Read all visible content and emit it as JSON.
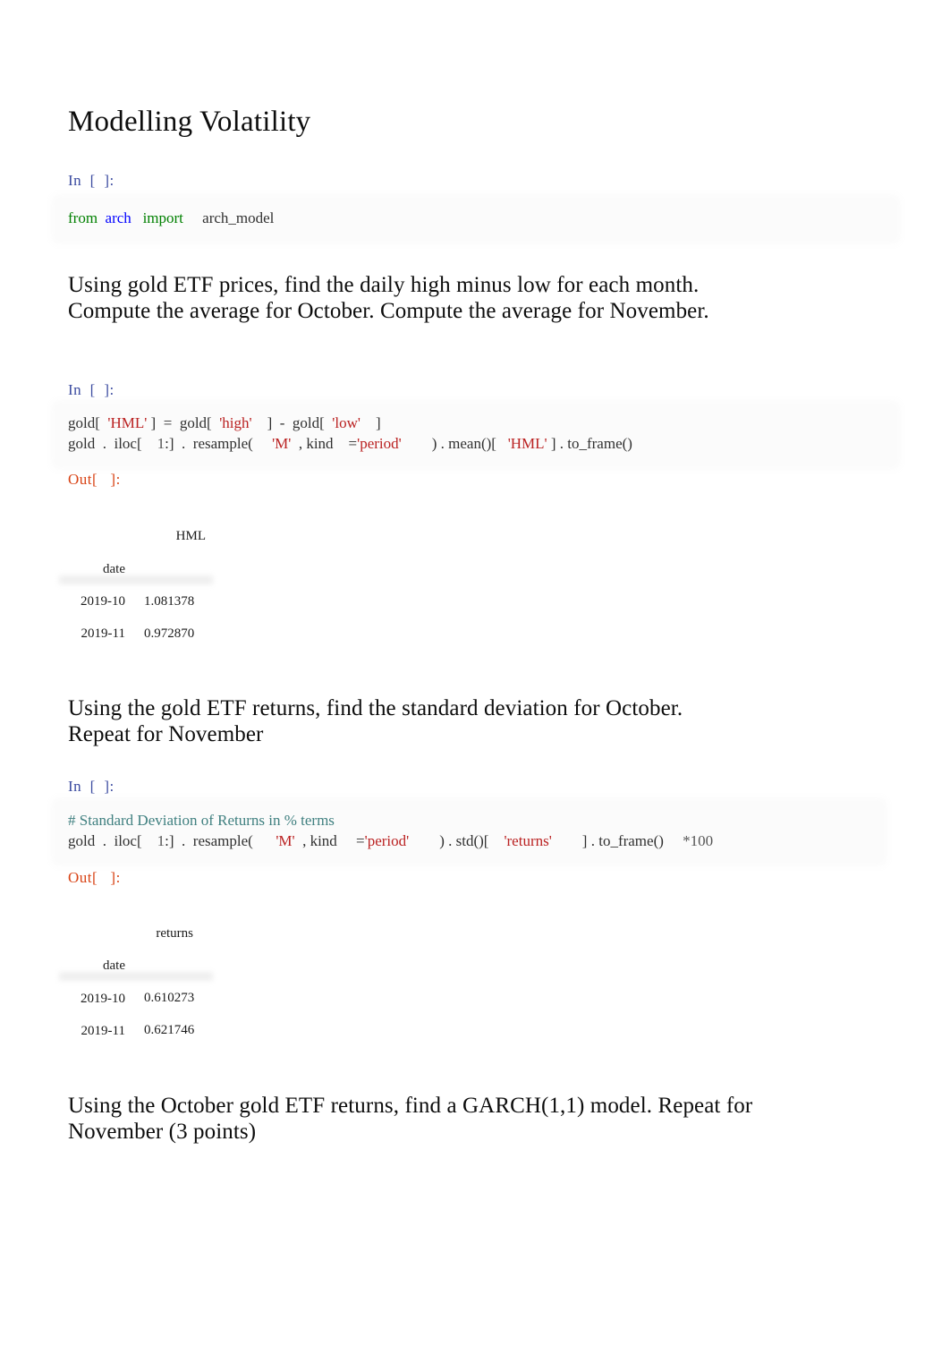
{
  "document": {
    "title": "Modelling Volatility"
  },
  "cells": [
    {
      "kind": "code",
      "prompt": "In  [  ]:",
      "lines": [
        [
          {
            "t": "from",
            "c": "kw"
          },
          {
            "t": "  ",
            "c": "plain"
          },
          {
            "t": "arch",
            "c": "name"
          },
          {
            "t": "   ",
            "c": "plain"
          },
          {
            "t": "import",
            "c": "kw"
          },
          {
            "t": "     ",
            "c": "plain"
          },
          {
            "t": "arch_model",
            "c": "plain"
          }
        ]
      ]
    },
    {
      "kind": "markdown",
      "text": "Using gold ETF prices, find the daily high minus low for each month. Compute the average for October. Compute the average for November."
    },
    {
      "kind": "code",
      "prompt": "In  [  ]:",
      "lines": [
        [
          {
            "t": "gold[",
            "c": "plain"
          },
          {
            "t": "  ",
            "c": "plain"
          },
          {
            "t": "'HML'",
            "c": "str"
          },
          {
            "t": " ]",
            "c": "plain"
          },
          {
            "t": "  =  ",
            "c": "plain"
          },
          {
            "t": "gold[",
            "c": "plain"
          },
          {
            "t": "  ",
            "c": "plain"
          },
          {
            "t": "'high'",
            "c": "str"
          },
          {
            "t": "    ]",
            "c": "plain"
          },
          {
            "t": "  -  ",
            "c": "plain"
          },
          {
            "t": "gold[",
            "c": "plain"
          },
          {
            "t": "  ",
            "c": "plain"
          },
          {
            "t": "'low'",
            "c": "str"
          },
          {
            "t": "    ]",
            "c": "plain"
          }
        ],
        [
          {
            "t": "gold",
            "c": "plain"
          },
          {
            "t": "  .  ",
            "c": "plain"
          },
          {
            "t": "iloc[",
            "c": "plain"
          },
          {
            "t": "    ",
            "c": "plain"
          },
          {
            "t": "1",
            "c": "num"
          },
          {
            "t": ":]",
            "c": "plain"
          },
          {
            "t": "  .  ",
            "c": "plain"
          },
          {
            "t": "resample(",
            "c": "plain"
          },
          {
            "t": "     ",
            "c": "plain"
          },
          {
            "t": "'M'",
            "c": "str"
          },
          {
            "t": "  , kind",
            "c": "plain"
          },
          {
            "t": "    =",
            "c": "plain"
          },
          {
            "t": "'period'",
            "c": "str"
          },
          {
            "t": "        )",
            "c": "plain"
          },
          {
            "t": " . ",
            "c": "plain"
          },
          {
            "t": "mean()[",
            "c": "plain"
          },
          {
            "t": "   ",
            "c": "plain"
          },
          {
            "t": "'HML'",
            "c": "str"
          },
          {
            "t": " ]",
            "c": "plain"
          },
          {
            "t": " . ",
            "c": "plain"
          },
          {
            "t": "to_frame()",
            "c": "plain"
          }
        ]
      ]
    },
    {
      "kind": "output",
      "prompt": "Out[   ]:",
      "table": {
        "column_header": "HML",
        "index_name": "date",
        "rows": [
          {
            "index": "2019-10",
            "value": "1.081378"
          },
          {
            "index": "2019-11",
            "value": "0.972870"
          }
        ]
      }
    },
    {
      "kind": "markdown",
      "text": "Using the gold ETF returns, find the standard deviation for October. Repeat for November"
    },
    {
      "kind": "code",
      "prompt": "In  [  ]:",
      "lines": [
        [
          {
            "t": "# Standard Deviation of Returns in % terms",
            "c": "com"
          }
        ],
        [
          {
            "t": "gold",
            "c": "plain"
          },
          {
            "t": "  .  ",
            "c": "plain"
          },
          {
            "t": "iloc[",
            "c": "plain"
          },
          {
            "t": "    ",
            "c": "plain"
          },
          {
            "t": "1",
            "c": "num"
          },
          {
            "t": ":]",
            "c": "plain"
          },
          {
            "t": "  .  ",
            "c": "plain"
          },
          {
            "t": "resample(",
            "c": "plain"
          },
          {
            "t": "      ",
            "c": "plain"
          },
          {
            "t": "'M'",
            "c": "str"
          },
          {
            "t": "  , kind",
            "c": "plain"
          },
          {
            "t": "     =",
            "c": "plain"
          },
          {
            "t": "'period'",
            "c": "str"
          },
          {
            "t": "        )",
            "c": "plain"
          },
          {
            "t": " . ",
            "c": "plain"
          },
          {
            "t": "std()[",
            "c": "plain"
          },
          {
            "t": "    ",
            "c": "plain"
          },
          {
            "t": "'returns'",
            "c": "str"
          },
          {
            "t": "        ]",
            "c": "plain"
          },
          {
            "t": " . ",
            "c": "plain"
          },
          {
            "t": "to_frame()",
            "c": "plain"
          },
          {
            "t": "     ",
            "c": "plain"
          },
          {
            "t": "*100",
            "c": "num"
          }
        ]
      ]
    },
    {
      "kind": "output",
      "prompt": "Out[   ]:",
      "table": {
        "column_header": "returns",
        "index_name": "date",
        "rows": [
          {
            "index": "2019-10",
            "value": "0.610273"
          },
          {
            "index": "2019-11",
            "value": "0.621746"
          }
        ]
      }
    },
    {
      "kind": "markdown",
      "text": "Using the October gold ETF returns, find a GARCH(1,1) model. Repeat for November (3 points)"
    }
  ],
  "colors": {
    "prompt_in": "#3b4ba0",
    "prompt_out": "#d84315",
    "keyword": "#008000",
    "name": "#0000ff",
    "string": "#ba2121",
    "comment": "#408080",
    "code_background": "#fbfbfb"
  }
}
